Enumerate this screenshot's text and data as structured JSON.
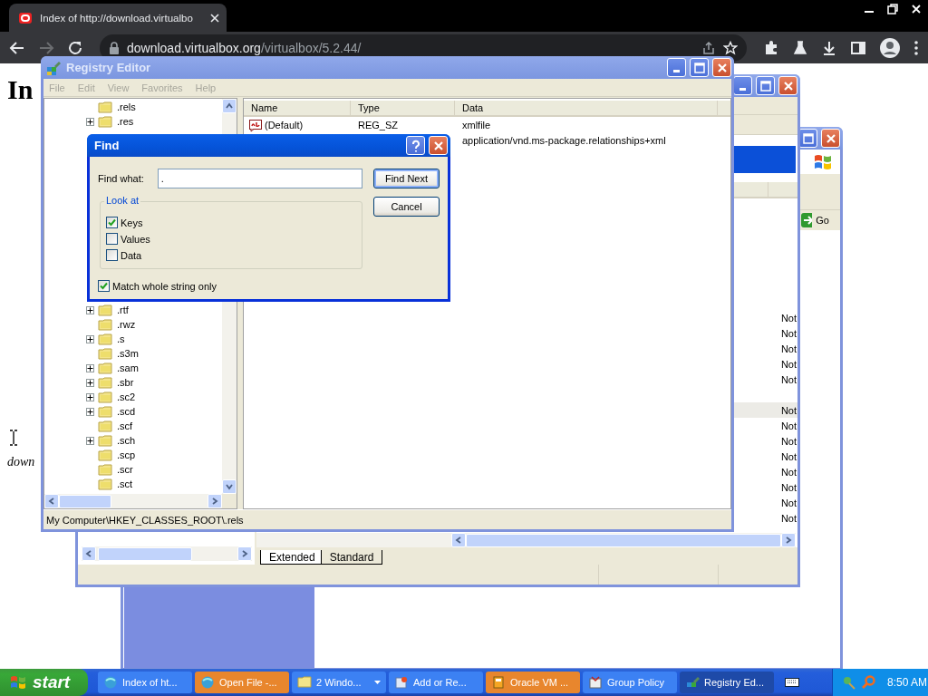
{
  "browser": {
    "tab": {
      "title": "Index of http://download.virtualbo",
      "selected": true
    },
    "address": {
      "host": "download.virtualbox.org",
      "path": "/virtualbox/5.2.44/"
    }
  },
  "page": {
    "heading": "In",
    "link": "down"
  },
  "background_window": {
    "go_button": "Go"
  },
  "console_window": {
    "rows": [
      {
        "status": "Not",
        "selected": false
      },
      {
        "status": "Not",
        "selected": false
      },
      {
        "status": "Not",
        "selected": false
      },
      {
        "status": "Not",
        "selected": false
      },
      {
        "status": "Not",
        "selected": false
      },
      {},
      {
        "status": "Not",
        "selected": true
      },
      {
        "status": "Not",
        "selected": false
      },
      {
        "status": "Not",
        "selected": false
      },
      {
        "status": "Not",
        "selected": false
      },
      {
        "status": "Not",
        "selected": false
      },
      {
        "status": "Not",
        "selected": false
      },
      {
        "status": "Not",
        "selected": false
      },
      {
        "status": "Not",
        "selected": false
      }
    ],
    "view_tabs": [
      {
        "label": "Extended",
        "selected": true
      },
      {
        "label": "Standard",
        "selected": false
      }
    ]
  },
  "registry_editor": {
    "title": "Registry Editor",
    "menu": [
      {
        "label": "File",
        "disabled": true
      },
      {
        "label": "Edit",
        "disabled": true
      },
      {
        "label": "View",
        "disabled": true
      },
      {
        "label": "Favorites",
        "disabled": true
      },
      {
        "label": "Help",
        "disabled": true
      }
    ],
    "tree_upper": [
      {
        "label": ".rels",
        "expandable": false
      },
      {
        "label": ".res",
        "expandable": true
      }
    ],
    "tree_lower": [
      {
        "label": ".rtf",
        "expandable": true
      },
      {
        "label": ".rwz",
        "expandable": false
      },
      {
        "label": ".s",
        "expandable": true
      },
      {
        "label": ".s3m",
        "expandable": false
      },
      {
        "label": ".sam",
        "expandable": true
      },
      {
        "label": ".sbr",
        "expandable": true
      },
      {
        "label": ".sc2",
        "expandable": true
      },
      {
        "label": ".scd",
        "expandable": true
      },
      {
        "label": ".scf",
        "expandable": false
      },
      {
        "label": ".sch",
        "expandable": true
      },
      {
        "label": ".scp",
        "expandable": false
      },
      {
        "label": ".scr",
        "expandable": false
      },
      {
        "label": ".sct",
        "expandable": false
      }
    ],
    "columns": [
      "Name",
      "Type",
      "Data"
    ],
    "values": [
      {
        "name": "(Default)",
        "type": "REG_SZ",
        "data": "xmlfile"
      },
      {
        "data": "application/vnd.ms-package.relationships+xml"
      }
    ],
    "status_bar": "My Computer\\HKEY_CLASSES_ROOT\\.rels"
  },
  "find_dialog": {
    "title": "Find",
    "find_what_label": "Find what:",
    "find_what_value": ".",
    "look_at_label": "Look at",
    "options": [
      {
        "label": "Keys",
        "checked": true
      },
      {
        "label": "Values",
        "checked": false
      },
      {
        "label": "Data",
        "checked": false
      }
    ],
    "match_whole": {
      "label": "Match whole string only",
      "checked": true
    },
    "buttons": [
      {
        "label": "Find Next",
        "default": true
      },
      {
        "label": "Cancel",
        "default": false
      }
    ]
  },
  "taskbar": {
    "start": "start",
    "buttons": [
      {
        "label": "Index of ht...",
        "kind": "browser",
        "selected": false,
        "flashing": false
      },
      {
        "label": "Open File -...",
        "kind": "browser",
        "selected": false,
        "flashing": true
      },
      {
        "label": "2 Windo...",
        "kind": "folder",
        "selected": false,
        "flashing": false,
        "grouped": true
      },
      {
        "label": "Add or Re...",
        "kind": "programs",
        "selected": false,
        "flashing": false
      },
      {
        "label": "Oracle VM ...",
        "kind": "vm",
        "selected": false,
        "flashing": true
      },
      {
        "label": "Group Policy",
        "kind": "policy",
        "selected": false,
        "flashing": false
      },
      {
        "label": "Registry Ed...",
        "kind": "registry",
        "selected": true,
        "flashing": false
      }
    ],
    "clock": "8:50 AM"
  }
}
